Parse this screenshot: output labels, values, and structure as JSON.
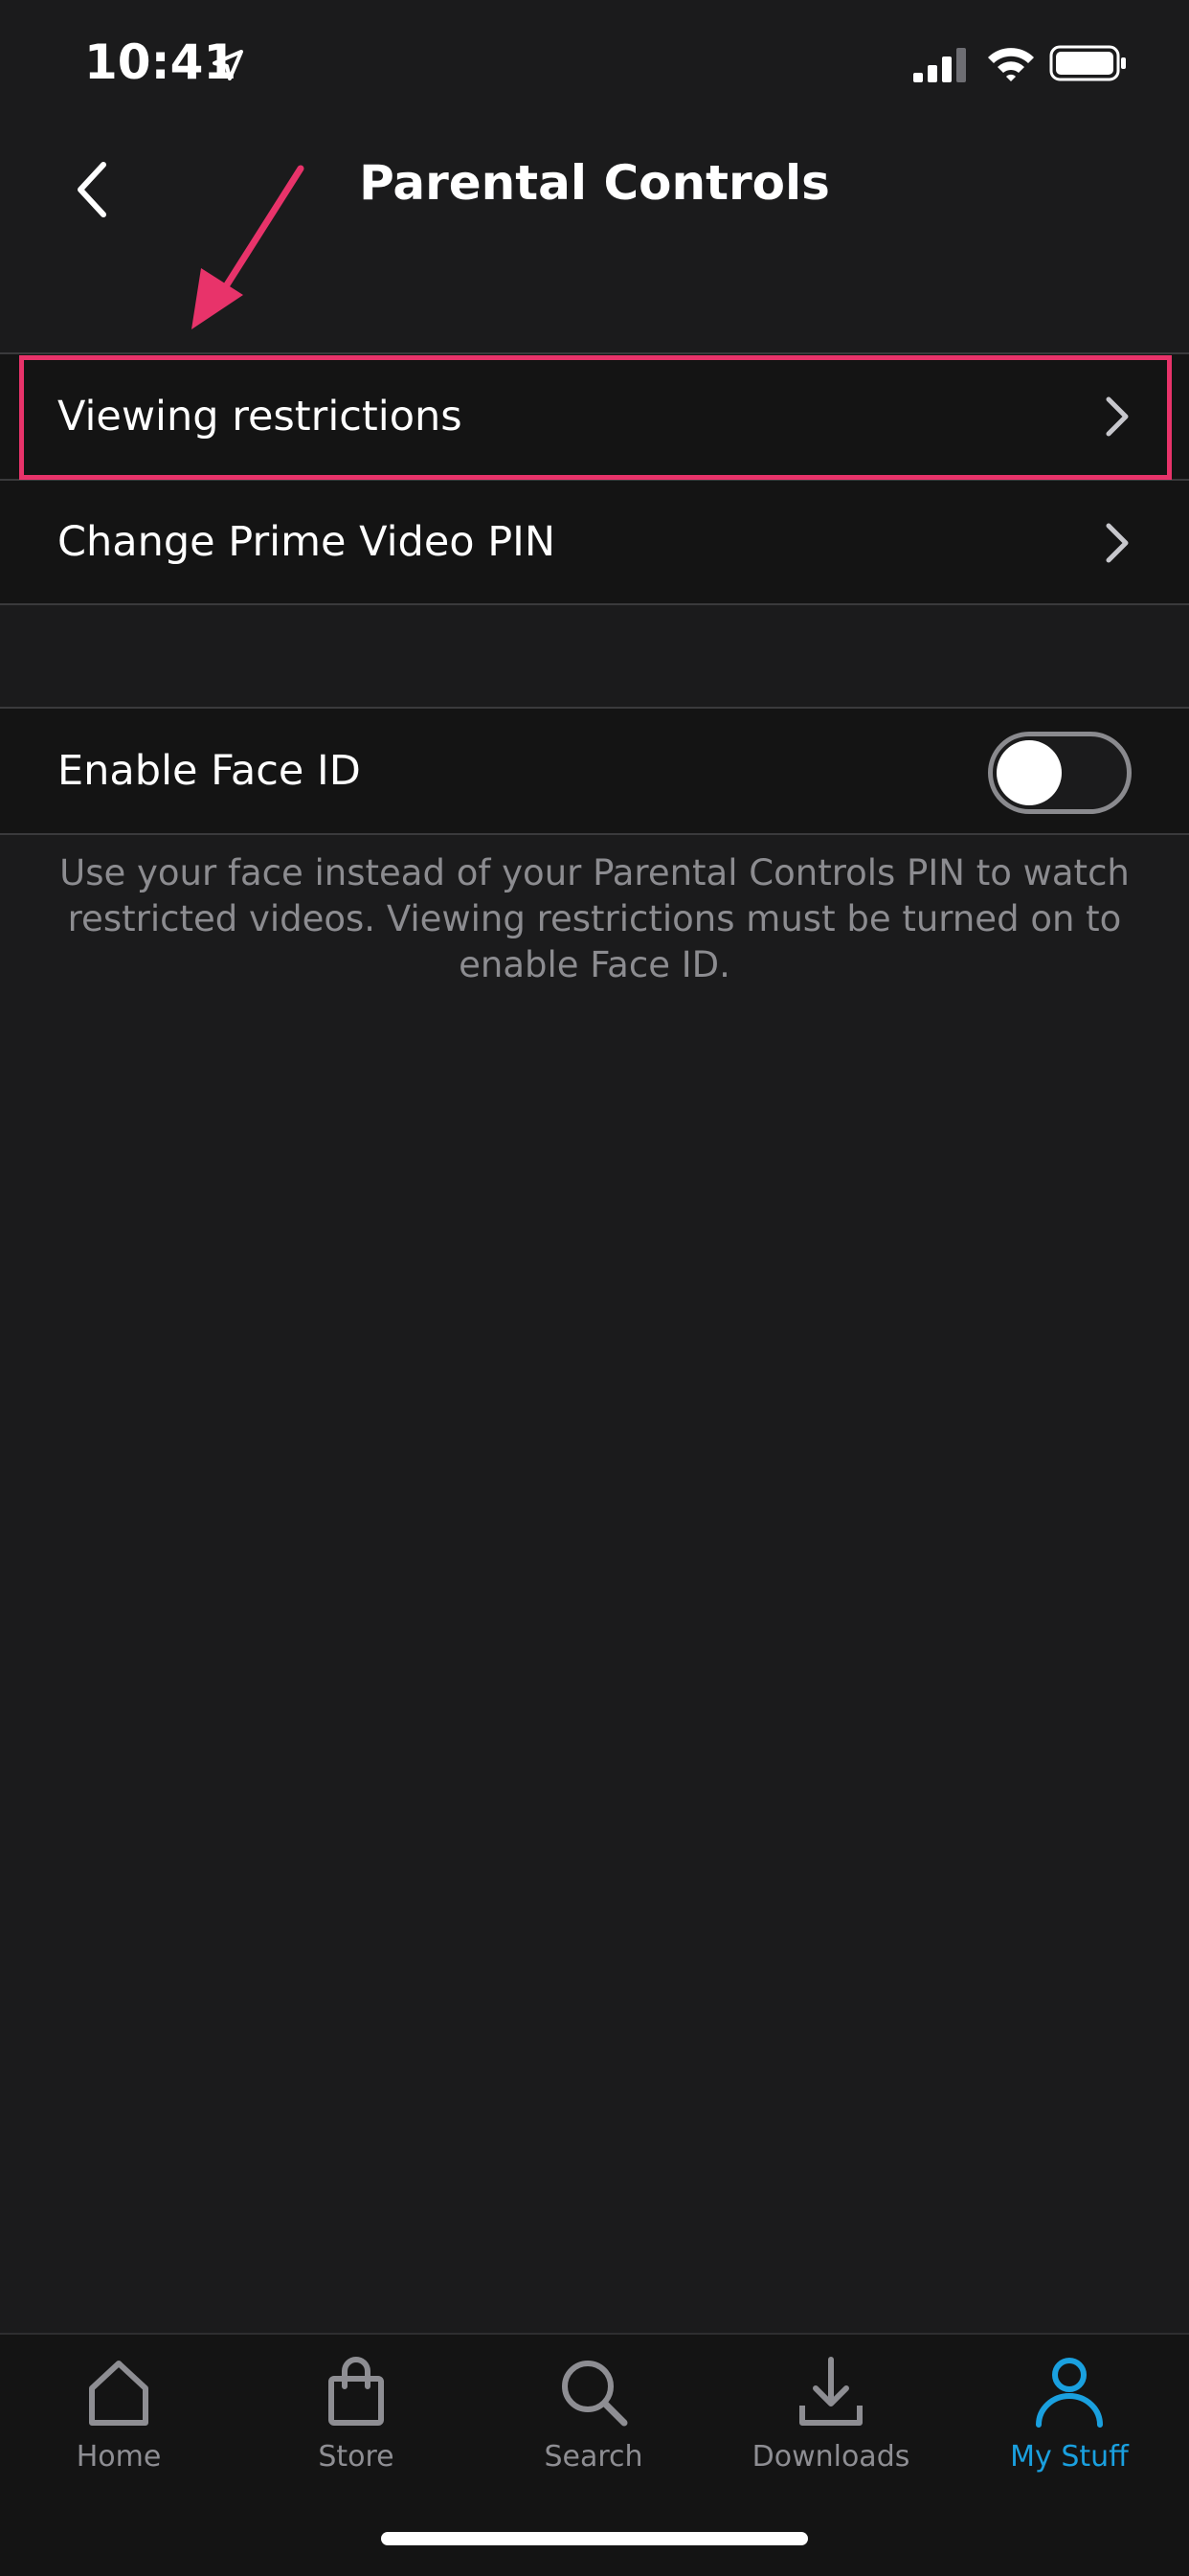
{
  "status_bar": {
    "time": "10:41"
  },
  "nav": {
    "title": "Parental Controls"
  },
  "settings": {
    "rows": [
      {
        "label": "Viewing restrictions"
      },
      {
        "label": "Change Prime Video PIN"
      }
    ],
    "face_id": {
      "label": "Enable Face ID",
      "enabled": false
    },
    "footnote": "Use your face instead of your Parental Controls PIN to watch restricted videos. Viewing restrictions must be turned on to enable Face ID."
  },
  "tabs": [
    {
      "label": "Home",
      "icon": "home-icon",
      "active": false
    },
    {
      "label": "Store",
      "icon": "shopping-bag-icon",
      "active": false
    },
    {
      "label": "Search",
      "icon": "search-icon",
      "active": false
    },
    {
      "label": "Downloads",
      "icon": "download-icon",
      "active": false
    },
    {
      "label": "My Stuff",
      "icon": "person-icon",
      "active": true
    }
  ],
  "colors": {
    "background": "#1b1b1c",
    "row_background": "#141414",
    "highlight": "#e8336a",
    "accent": "#1aa0df",
    "secondary_text": "#8c8c90"
  }
}
